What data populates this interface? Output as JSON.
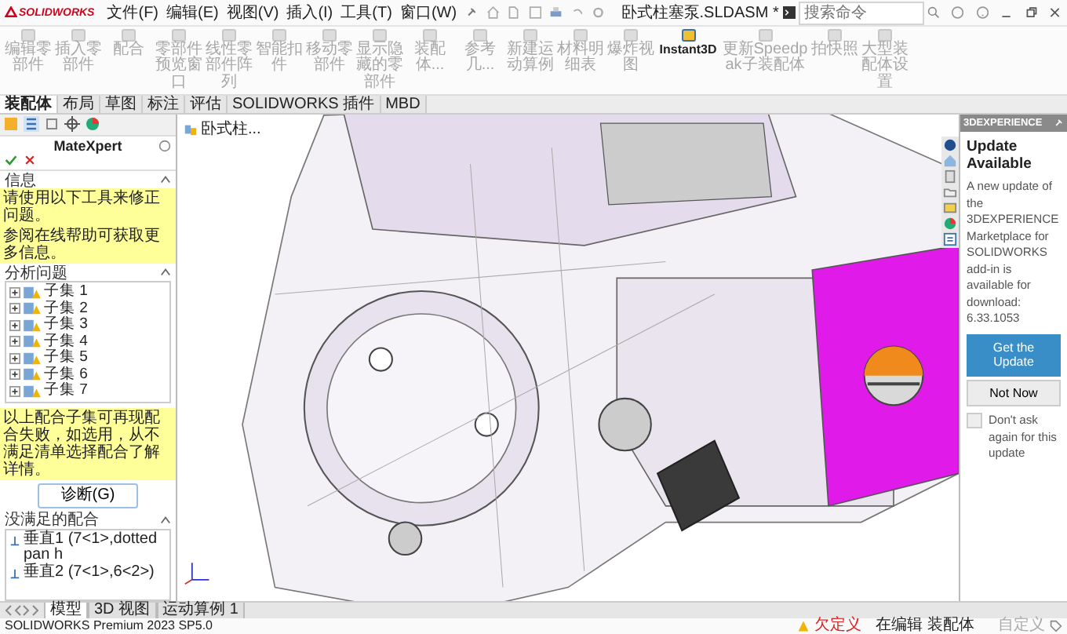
{
  "title_bar": {
    "app": "SOLIDWORKS",
    "menus": [
      "文件(F)",
      "编辑(E)",
      "视图(V)",
      "插入(I)",
      "工具(T)",
      "窗口(W)"
    ],
    "document": "卧式柱塞泵.SLDASM *",
    "search": {
      "placeholder": "搜索命令"
    }
  },
  "ribbon": {
    "buttons": [
      {
        "label": "编辑零部件",
        "disabled": true
      },
      {
        "label": "插入零部件",
        "disabled": true
      },
      {
        "label": "配合",
        "disabled": true
      },
      {
        "label": "零部件预览窗口",
        "disabled": true
      },
      {
        "label": "线性零部件阵列",
        "disabled": true
      },
      {
        "label": "智能扣件",
        "disabled": true
      },
      {
        "label": "移动零部件",
        "disabled": true
      },
      {
        "label": "显示隐藏的零部件",
        "disabled": true
      },
      {
        "label": "装配体...",
        "disabled": true
      },
      {
        "label": "参考几...",
        "disabled": true
      },
      {
        "label": "新建运动算例",
        "disabled": true
      },
      {
        "label": "材料明细表",
        "disabled": true
      },
      {
        "label": "爆炸视图",
        "disabled": true
      },
      {
        "label": "Instant3D",
        "disabled": false
      },
      {
        "label": "更新Speedpak子装配体",
        "disabled": true
      },
      {
        "label": "拍快照",
        "disabled": true
      },
      {
        "label": "大型装配体设置",
        "disabled": true
      }
    ]
  },
  "command_tabs": [
    {
      "label": "装配体",
      "selected": true
    },
    {
      "label": "布局",
      "selected": false
    },
    {
      "label": "草图",
      "selected": false
    },
    {
      "label": "标注",
      "selected": false
    },
    {
      "label": "评估",
      "selected": false
    },
    {
      "label": "SOLIDWORKS 插件",
      "selected": false
    },
    {
      "label": "MBD",
      "selected": false
    }
  ],
  "property_manager": {
    "title": "MateXpert",
    "info": {
      "heading": "信息",
      "messages": [
        "请使用以下工具来修正问题。",
        "参阅在线帮助可获取更多信息。"
      ]
    },
    "analysis": {
      "heading": "分析问题",
      "subsets": [
        {
          "label": "子集 1",
          "expanded": false
        },
        {
          "label": "子集 2",
          "expanded": false
        },
        {
          "label": "子集 3",
          "expanded": false
        },
        {
          "label": "子集 4",
          "expanded": false
        },
        {
          "label": "子集 5",
          "expanded": false
        },
        {
          "label": "子集 6",
          "expanded": false
        },
        {
          "label": "子集 7",
          "expanded": false
        }
      ],
      "note": "以上配合子集可再现配合失败，如选用，从不满足清单选择配合了解详情。",
      "button": "诊断(G)"
    },
    "unsatisfied": {
      "heading": "没满足的配合",
      "mates": [
        "垂直1 (7<1>,dotted pan h",
        "垂直2 (7<1>,6<2>)"
      ]
    }
  },
  "viewport": {
    "tree_flyout": "卧式柱..."
  },
  "task_pane": {
    "header": "3DEXPERIENCE",
    "title": "Update Available",
    "message": "A new update of the 3DEXPERIENCE Marketplace for SOLIDWORKS add-in is available for download: 6.33.1053",
    "primary_button": "Get the Update",
    "secondary_button": "Not Now",
    "checkbox": {
      "label": "Don't ask again for this update",
      "checked": false
    }
  },
  "bottom_tabs": [
    {
      "label": "模型",
      "selected": true
    },
    {
      "label": "3D 视图",
      "selected": false
    },
    {
      "label": "运动算例 1",
      "selected": false
    }
  ],
  "status_bar": {
    "product": "SOLIDWORKS Premium 2023 SP5.0",
    "state": "欠定义",
    "mode": "在编辑 装配体",
    "units": "自定义"
  }
}
